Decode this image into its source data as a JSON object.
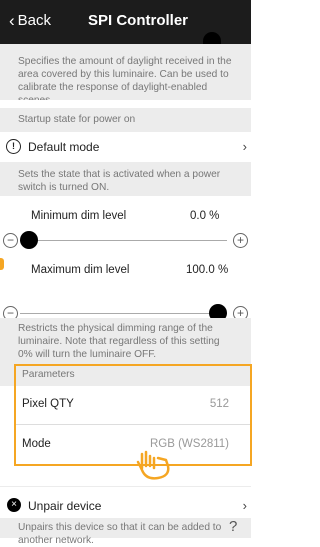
{
  "header": {
    "back_label": "Back",
    "title": "SPI Controller"
  },
  "daylight_desc": "Specifies the amount of daylight received in the area covered by this luminaire. Can be used to calibrate the response of daylight-enabled scenes.",
  "startup": {
    "section_label": "Startup state for power on",
    "value": "Default mode",
    "desc": "Sets the state that is activated when a power switch is turned ON."
  },
  "min_dim": {
    "label": "Minimum dim level",
    "value": "0.0 %",
    "fraction": 0.0
  },
  "max_dim": {
    "label": "Maximum dim level",
    "value": "100.0 %",
    "fraction": 1.0
  },
  "dim_desc": "Restricts the physical dimming range of the luminaire. Note that regardless of this setting 0% will turn the luminaire OFF.",
  "parameters": {
    "section_label": "Parameters",
    "pixel_qty_label": "Pixel QTY",
    "pixel_qty_value": "512",
    "mode_label": "Mode",
    "mode_value": "RGB (WS2811)"
  },
  "unpair": {
    "label": "Unpair device",
    "desc": "Unpairs this device so that it can be added to another network."
  },
  "help_mark": "?"
}
